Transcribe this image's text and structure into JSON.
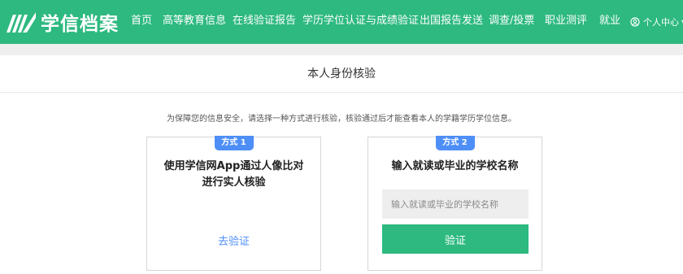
{
  "header": {
    "logo_text": "学信档案",
    "nav": [
      {
        "label": "首页"
      },
      {
        "label": "高等教育信息"
      },
      {
        "label": "在线验证报告"
      },
      {
        "label": "学历学位认证与成绩验证"
      },
      {
        "label": "出国报告发送"
      },
      {
        "label": "调查/投票"
      },
      {
        "label": "职业测评"
      },
      {
        "label": "就业"
      }
    ],
    "user_menu_label": "个人中心"
  },
  "page": {
    "title": "本人身份核验",
    "notice": "为保障您的信息安全，请选择一种方式进行核验，核验通过后才能查看本人的学籍学历学位信息。"
  },
  "method1": {
    "badge": "方式 1",
    "title_line1": "使用学信网App通过人像比对",
    "title_line2": "进行实人核验",
    "link_label": "去验证"
  },
  "method2": {
    "badge": "方式 2",
    "title": "输入就读或毕业的学校名称",
    "input_placeholder": "输入就读或毕业的学校名称",
    "input_value": "",
    "button_label": "验证"
  },
  "colors": {
    "brand_green": "#2db980",
    "badge_blue": "#4e8ef7",
    "link_blue": "#4e8ef7"
  },
  "icons": [
    "logo-book-icon",
    "user-circle-icon",
    "caret-down-icon"
  ]
}
